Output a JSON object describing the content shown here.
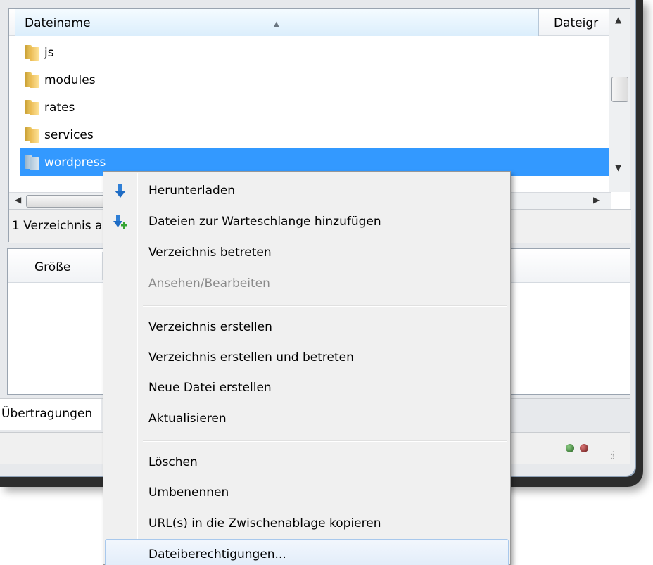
{
  "file_list": {
    "columns": {
      "name": "Dateiname",
      "size": "Dateigr"
    },
    "rows": [
      {
        "name": "js",
        "selected": false
      },
      {
        "name": "modules",
        "selected": false
      },
      {
        "name": "rates",
        "selected": false
      },
      {
        "name": "services",
        "selected": false
      },
      {
        "name": "wordpress",
        "selected": true
      }
    ],
    "status": "1 Verzeichnis ausgewählt."
  },
  "queue": {
    "size_column": "Größe",
    "tab_label": "Übertragungen"
  },
  "context_menu": {
    "items": [
      {
        "label": "Herunterladen",
        "icon": "download-arrow-icon",
        "enabled": true
      },
      {
        "label": "Dateien zur Warteschlange hinzufügen",
        "icon": "add-to-queue-icon",
        "enabled": true
      },
      {
        "label": "Verzeichnis betreten",
        "enabled": true
      },
      {
        "label": "Ansehen/Bearbeiten",
        "enabled": false
      },
      {
        "label": "Verzeichnis erstellen",
        "enabled": true
      },
      {
        "label": "Verzeichnis erstellen und betreten",
        "enabled": true
      },
      {
        "label": "Neue Datei erstellen",
        "enabled": true
      },
      {
        "label": "Aktualisieren",
        "enabled": true
      },
      {
        "label": "Löschen",
        "enabled": true
      },
      {
        "label": "Umbenennen",
        "enabled": true
      },
      {
        "label": "URL(s) in die Zwischenablage kopieren",
        "enabled": true
      },
      {
        "label": "Dateiberechtigungen...",
        "enabled": true,
        "hovered": true
      }
    ]
  },
  "colors": {
    "selection": "#3399ff",
    "menu_bg": "#f0f0f0",
    "led_green": "#2e7d2a",
    "led_red": "#7a1a1a"
  }
}
